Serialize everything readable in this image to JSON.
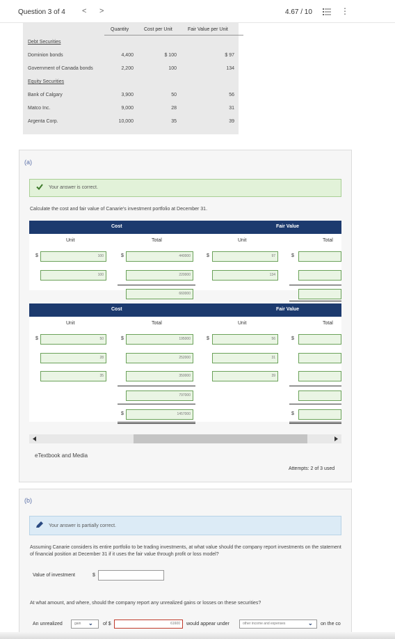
{
  "header": {
    "question_label": "Question 3 of 4",
    "prev_glyph": "<",
    "next_glyph": ">",
    "score": "4.67 / 10",
    "more_glyph": "⋮"
  },
  "info_table": {
    "col_headers": [
      "Quantity",
      "Cost per Unit",
      "Fair Value per Unit"
    ],
    "debt_heading": "Debt Securities",
    "equity_heading": "Equity Securities",
    "rows": [
      {
        "name": "Dominion bonds",
        "qty": "4,400",
        "cost": "$ 100",
        "fv": "$ 97"
      },
      {
        "name": "Government of Canada bonds",
        "qty": "2,200",
        "cost": "100",
        "fv": "134"
      },
      {
        "name": "Bank of Calgary",
        "qty": "3,900",
        "cost": "50",
        "fv": "56"
      },
      {
        "name": "Matco Inc.",
        "qty": "9,000",
        "cost": "28",
        "fv": "31"
      },
      {
        "name": "Argenta Corp.",
        "qty": "10,000",
        "cost": "35",
        "fv": "39"
      }
    ]
  },
  "part_a": {
    "label": "(a)",
    "banner": "Your answer is correct.",
    "instruction": "Calculate the cost and fair value of Canarie's investment portfolio at December 31.",
    "cost_header": "Cost",
    "fv_header": "Fair Value",
    "unit_label": "Unit",
    "total_label": "Total",
    "dollar": "$",
    "debt": {
      "cost_units": [
        "100",
        "100"
      ],
      "cost_totals": [
        "440000",
        "220000"
      ],
      "cost_subtotal": "660000",
      "fv_units": [
        "97",
        "134"
      ]
    },
    "equity": {
      "cost_units": [
        "50",
        "28",
        "35"
      ],
      "cost_totals": [
        "195000",
        "252000",
        "350000"
      ],
      "cost_subtotal": "797000",
      "grand_total": "1457000",
      "fv_units": [
        "56",
        "31",
        "39"
      ]
    },
    "etextbook": "eTextbook and Media",
    "attempts": "Attempts: 2 of 3 used"
  },
  "part_b": {
    "label": "(b)",
    "banner": "Your answer is partially correct.",
    "question": "Assuming Canarie considers its entire portfolio to be trading investments, at what value should the company report investments on the statement of financial position at December 31 if it uses the fair value through profit or loss model?",
    "value_label": "Value of investment",
    "dollar": "$",
    "value_input": "",
    "question2": "At what amount, and where, should the company report any unrealized gains or losses on these securities?",
    "unrealized_label": "An unrealized",
    "gain_select": "gain",
    "of_label": "of $",
    "amount_input": "61600",
    "appear_label": "would appear under",
    "location_select": "other income and expenses",
    "tail_label": "on the co"
  },
  "colors": {
    "accent_navy": "#1c3a6e",
    "correct_green": "#6ba25a",
    "error_red": "#c0392b",
    "partial_blue": "#dcebf6"
  }
}
